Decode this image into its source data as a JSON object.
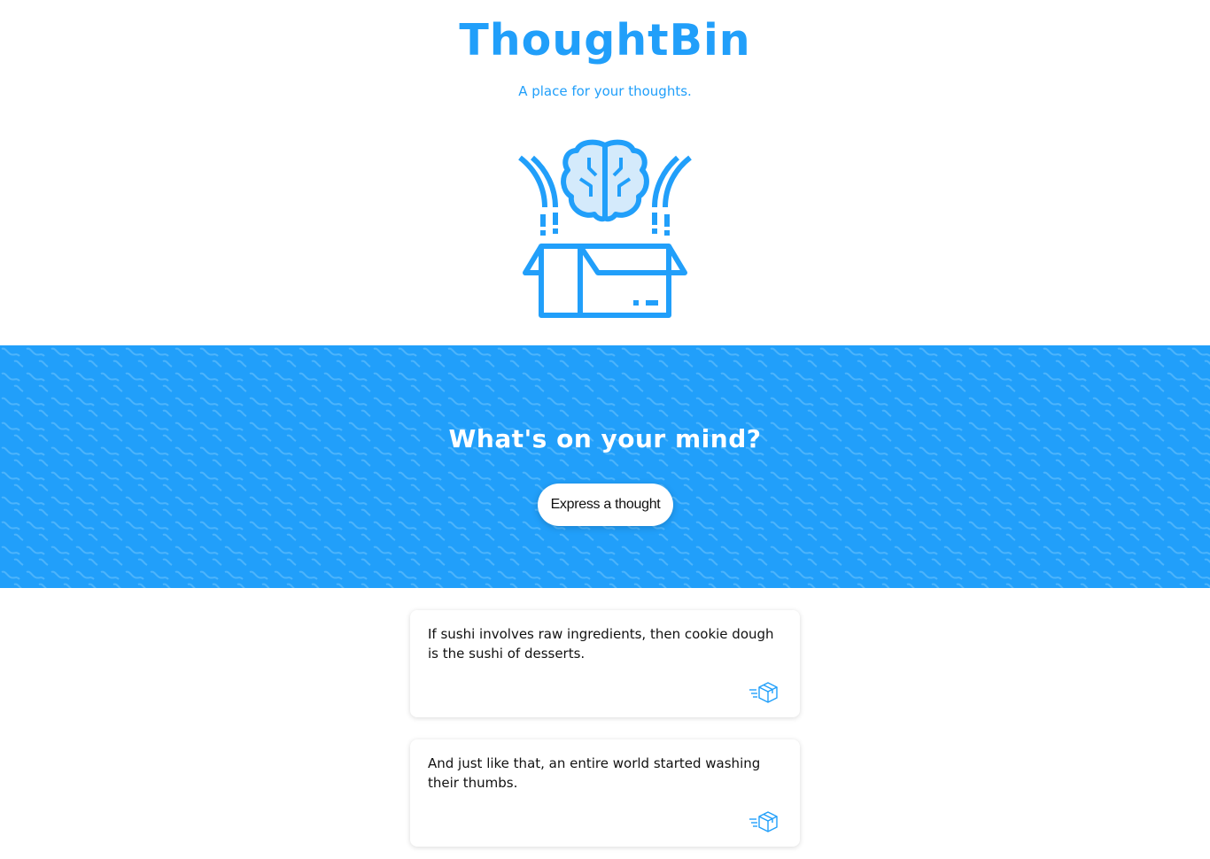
{
  "header": {
    "title": "ThoughtBin",
    "tagline": "A place for your thoughts.",
    "logo_icon": "brain-in-box-icon"
  },
  "hero": {
    "question": "What's on your mind?",
    "cta_label": "Express a thought"
  },
  "thoughts": [
    {
      "text": "If sushi involves raw ingredients, then cookie dough is the sushi of desserts.",
      "action_icon": "box-delivery-icon"
    },
    {
      "text": "And just like that, an entire world started washing their thumbs.",
      "action_icon": "box-delivery-icon"
    }
  ],
  "colors": {
    "accent": "#219ffa",
    "background": "#ffffff",
    "text": "#111111"
  }
}
